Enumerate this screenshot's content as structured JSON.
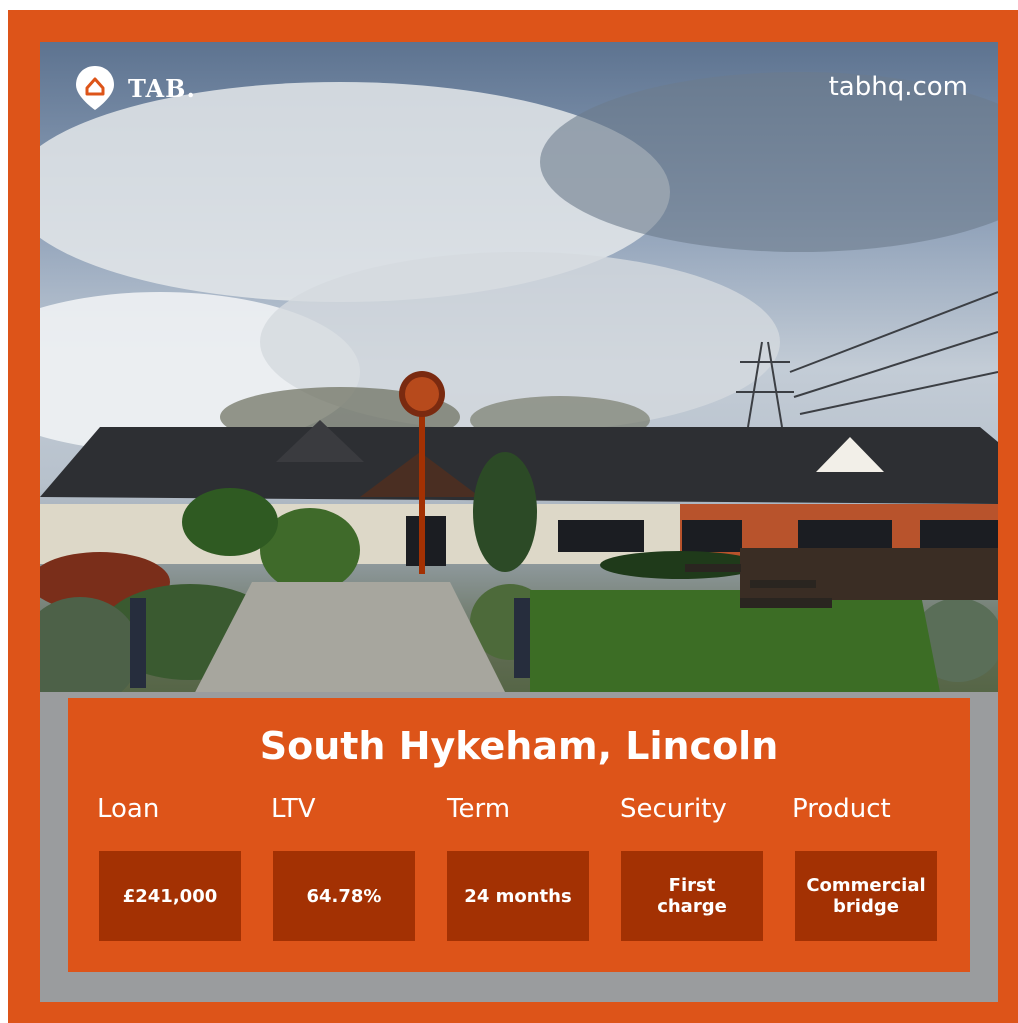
{
  "brand": {
    "logo_text": "TAB.",
    "website": "tabhq.com",
    "accent_color": "#dd5419",
    "box_color": "#a33103"
  },
  "photo": {
    "subject_icon": "building-photo"
  },
  "listing": {
    "location": "South Hykeham, Lincoln",
    "details": [
      {
        "label": "Loan",
        "value": "£241,000"
      },
      {
        "label": "LTV",
        "value": "64.78%"
      },
      {
        "label": "Term",
        "value": "24 months"
      },
      {
        "label": "Security",
        "value": "First\ncharge"
      },
      {
        "label": "Product",
        "value": "Commercial\nbridge"
      }
    ]
  }
}
